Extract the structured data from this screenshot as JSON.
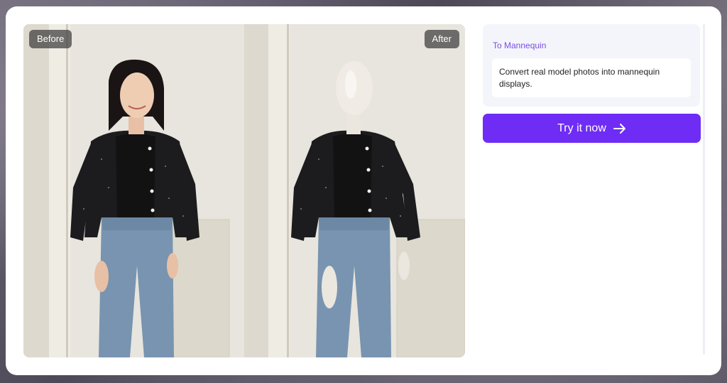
{
  "comparison": {
    "before_label": "Before",
    "after_label": "After"
  },
  "panel": {
    "feature_title": "To Mannequin",
    "feature_description": "Convert real model photos into mannequin displays."
  },
  "cta": {
    "label": "Try it now",
    "icon": "arrow-right-icon"
  },
  "colors": {
    "accent": "#6f2cf5",
    "feature_title": "#7a4fe0"
  }
}
